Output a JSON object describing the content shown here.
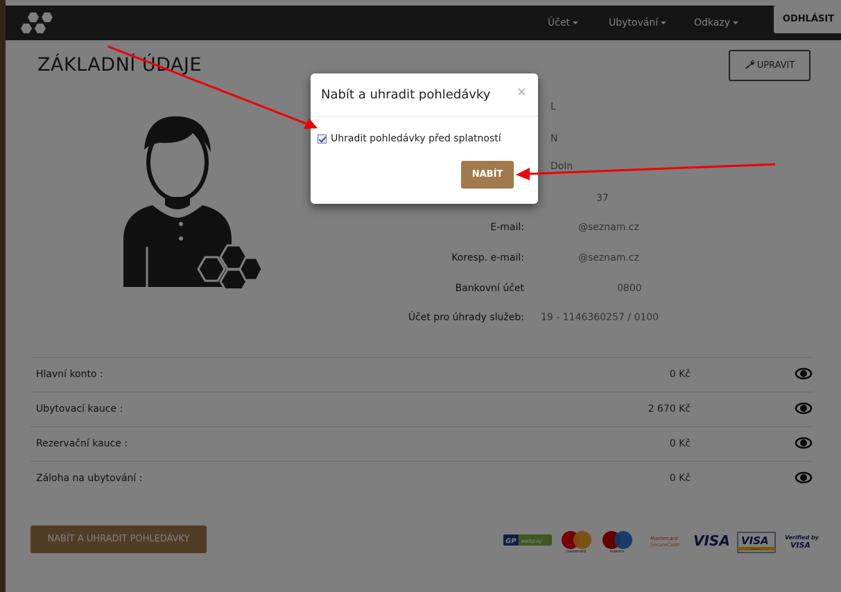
{
  "navbar": {
    "menu": [
      {
        "label": "Účet"
      },
      {
        "label": "Ubytování"
      },
      {
        "label": "Odkazy"
      }
    ],
    "logout_label": "ODHLÁSIT"
  },
  "page": {
    "title": "ZÁKLADNÍ ÚDAJE",
    "edit_label": "UPRAVIT"
  },
  "info": [
    {
      "label": "",
      "value": "L"
    },
    {
      "label": "",
      "value": "N"
    },
    {
      "label": "",
      "value": "Doln"
    },
    {
      "label": "",
      "value": "37"
    },
    {
      "label": "E-mail:",
      "value": "@seznam.cz"
    },
    {
      "label": "Koresp. e-mail:",
      "value": "@seznam.cz"
    },
    {
      "label": "Bankovní účet",
      "value": "0800"
    },
    {
      "label": "Účet pro úhrady služeb:",
      "value": "19 - 1146360257 / 0100"
    }
  ],
  "balances": [
    {
      "label": "Hlavní konto :",
      "value": "0 Kč"
    },
    {
      "label": "Ubytovací kauce :",
      "value": "2 670 Kč"
    },
    {
      "label": "Rezervační kauce :",
      "value": "0 Kč"
    },
    {
      "label": "Záloha na ubytování :",
      "value": "0 Kč"
    }
  ],
  "pay_button_label": "NABÍT A UHRADIT POHLEDÁVKY",
  "payment_logos": {
    "gp_text": "GP",
    "webpay_text": "webpay",
    "mastercard_text": "mastercard",
    "maestro_text": "maestro",
    "securecode_line1": "Mastercard",
    "securecode_line2": "SecureCode",
    "visa_text": "VISA",
    "visa_electron_text": "VISA",
    "visa_electron_sub": "Electron",
    "verified_line1": "Verified by",
    "verified_line2": "VISA"
  },
  "modal": {
    "title": "Nabít a uhradit pohledávky",
    "close_symbol": "×",
    "checkbox_label": "Uhradit pohledávky před splatností",
    "checkbox_checked": true,
    "submit_label": "NABÍT"
  },
  "colors": {
    "brand_brown": "#a07a4c",
    "navbar": "#2b2b2b",
    "arrow": "#ee0000"
  }
}
